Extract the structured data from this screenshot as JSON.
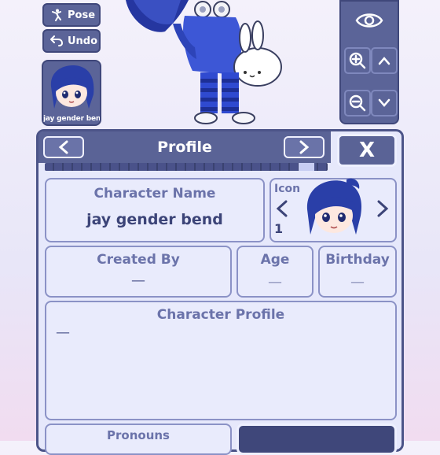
{
  "toolbar": {
    "pose_label": "Pose",
    "undo_label": "Undo"
  },
  "character_thumb": {
    "label": "jay gender bend"
  },
  "camera": {
    "view_icon": "eye-icon",
    "zoom_in_icon": "zoom-in-icon",
    "zoom_out_icon": "zoom-out-icon",
    "up_icon": "chevron-up-icon",
    "down_icon": "chevron-down-icon"
  },
  "profile_panel": {
    "title": "Profile",
    "prev_icon": "chevron-left-icon",
    "next_icon": "chevron-right-icon",
    "close_label": "X",
    "progress_fraction": 0.95,
    "character_name": {
      "label": "Character Name",
      "value": "jay gender bend"
    },
    "icon_picker": {
      "label": "Icon",
      "value": "1"
    },
    "created_by": {
      "label": "Created By",
      "value": "—"
    },
    "age": {
      "label": "Age",
      "value": "—"
    },
    "birthday": {
      "label": "Birthday",
      "value": "—"
    },
    "character_profile": {
      "label": "Character Profile",
      "value": "—"
    },
    "pronouns": {
      "label": "Pronouns"
    }
  },
  "colors": {
    "panel_dark": "#5a6396",
    "panel_light": "#e6e8fb",
    "label_text": "#6b73aa",
    "hair_blue": "#2a3fa8"
  }
}
